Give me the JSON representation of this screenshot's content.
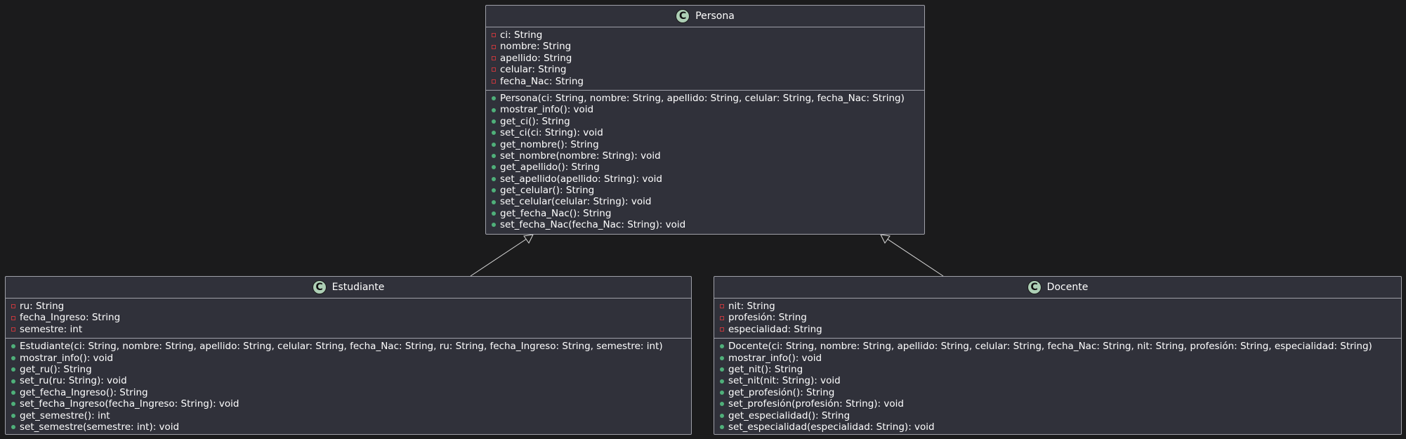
{
  "diagram": {
    "class_badge": "C",
    "colors": {
      "background": "#1b1b1c",
      "class_fill": "#30313a",
      "border": "#9fa0a8",
      "badge": "#adcfb5",
      "private_marker": "#c3383d",
      "public_marker": "#4fb07a"
    },
    "classes": {
      "persona": {
        "name": "Persona",
        "attributes": [
          "ci: String",
          "nombre: String",
          "apellido: String",
          "celular: String",
          "fecha_Nac: String"
        ],
        "methods": [
          "Persona(ci: String, nombre: String, apellido: String, celular: String, fecha_Nac: String)",
          "mostrar_info(): void",
          "get_ci(): String",
          "set_ci(ci: String): void",
          "get_nombre(): String",
          "set_nombre(nombre: String): void",
          "get_apellido(): String",
          "set_apellido(apellido: String): void",
          "get_celular(): String",
          "set_celular(celular: String): void",
          "get_fecha_Nac(): String",
          "set_fecha_Nac(fecha_Nac: String): void"
        ]
      },
      "estudiante": {
        "name": "Estudiante",
        "attributes": [
          "ru: String",
          "fecha_Ingreso: String",
          "semestre: int"
        ],
        "methods": [
          "Estudiante(ci: String, nombre: String, apellido: String, celular: String, fecha_Nac: String, ru: String, fecha_Ingreso: String, semestre: int)",
          "mostrar_info(): void",
          "get_ru(): String",
          "set_ru(ru: String): void",
          "get_fecha_Ingreso(): String",
          "set_fecha_Ingreso(fecha_Ingreso: String): void",
          "get_semestre(): int",
          "set_semestre(semestre: int): void"
        ]
      },
      "docente": {
        "name": "Docente",
        "attributes": [
          "nit: String",
          "profesión: String",
          "especialidad: String"
        ],
        "methods": [
          "Docente(ci: String, nombre: String, apellido: String, celular: String, fecha_Nac: String, nit: String, profesión: String, especialidad: String)",
          "mostrar_info(): void",
          "get_nit(): String",
          "set_nit(nit: String): void",
          "get_profesión(): String",
          "set_profesión(profesión: String): void",
          "get_especialidad(): String",
          "set_especialidad(especialidad: String): void"
        ]
      }
    }
  }
}
